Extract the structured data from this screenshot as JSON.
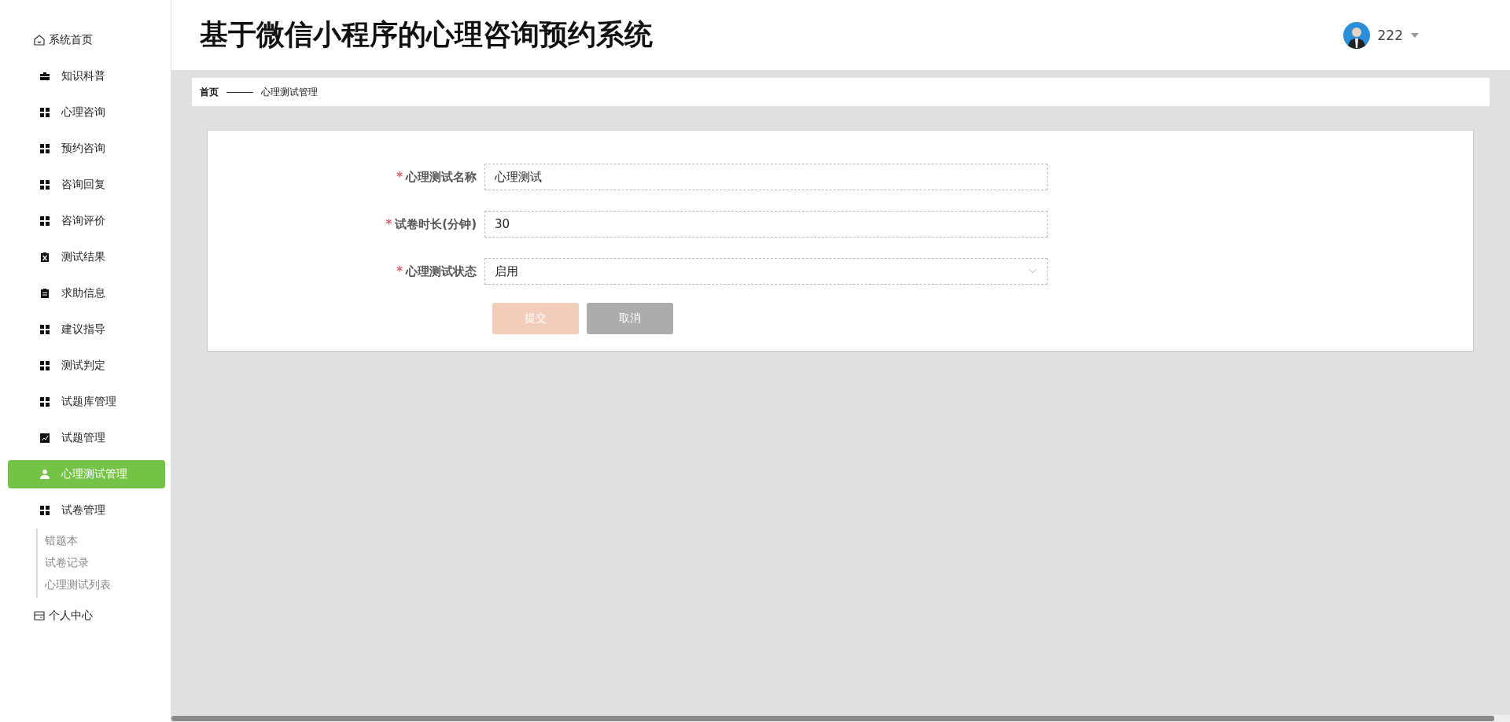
{
  "sidebar": {
    "items": [
      {
        "kind": "home",
        "label": "系统首页",
        "selected": false
      },
      {
        "kind": "briefcase",
        "label": "知识科普",
        "selected": false
      },
      {
        "kind": "grid",
        "label": "心理咨询",
        "selected": false
      },
      {
        "kind": "grid",
        "label": "预约咨询",
        "selected": false
      },
      {
        "kind": "grid",
        "label": "咨询回复",
        "selected": false
      },
      {
        "kind": "grid",
        "label": "咨询评价",
        "selected": false
      },
      {
        "kind": "clipboard-x",
        "label": "测试结果",
        "selected": false
      },
      {
        "kind": "clipboard",
        "label": "求助信息",
        "selected": false
      },
      {
        "kind": "grid",
        "label": "建议指导",
        "selected": false
      },
      {
        "kind": "grid",
        "label": "测试判定",
        "selected": false
      },
      {
        "kind": "grid",
        "label": "试题库管理",
        "selected": false
      },
      {
        "kind": "chart",
        "label": "试题管理",
        "selected": false
      },
      {
        "kind": "user",
        "label": "心理测试管理",
        "selected": true
      },
      {
        "kind": "grid",
        "label": "试卷管理",
        "selected": false,
        "expanded": true,
        "children": [
          {
            "label": "错题本",
            "selected": false
          },
          {
            "label": "试卷记录",
            "selected": false
          },
          {
            "label": "心理测试列表",
            "selected": false
          }
        ]
      },
      {
        "kind": "card",
        "label": "个人中心",
        "selected": false
      }
    ]
  },
  "header": {
    "title": "基于微信小程序的心理咨询预约系统",
    "user": "222"
  },
  "breadcrumb": [
    "首页",
    "心理测试管理"
  ],
  "form": {
    "fields": [
      {
        "kind": "text",
        "mark": "*",
        "label": "心理测试名称",
        "value": "心理测试"
      },
      {
        "kind": "text",
        "mark": "*",
        "label": "试卷时长(分钟)",
        "value": "30"
      },
      {
        "kind": "select",
        "mark": "*",
        "label": "心理测试状态",
        "value": "启用"
      }
    ],
    "buttons": [
      {
        "kind": "submit",
        "label": "提交"
      },
      {
        "kind": "cancel",
        "label": "取消"
      }
    ]
  }
}
